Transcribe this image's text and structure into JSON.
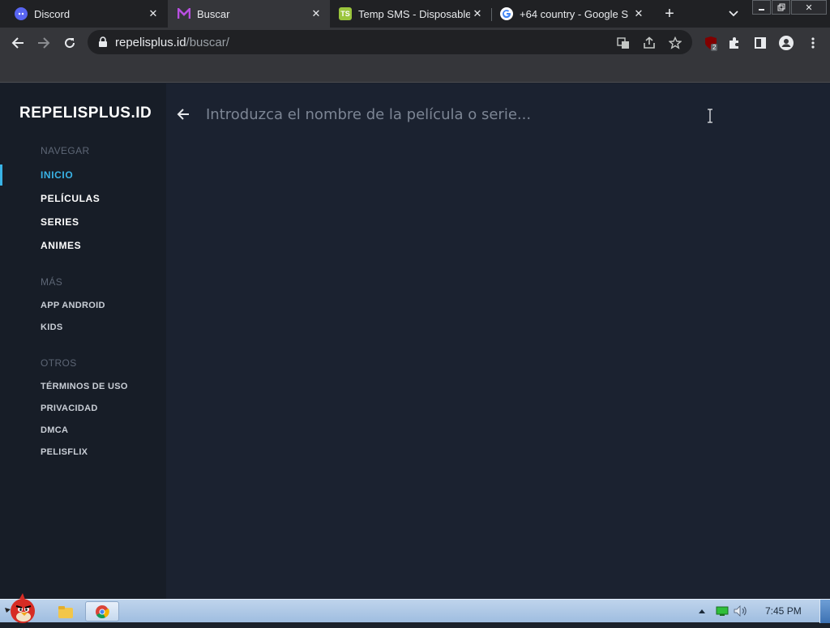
{
  "browser": {
    "tabs": [
      {
        "title": "Discord",
        "favicon": "discord-icon",
        "active": false
      },
      {
        "title": "Buscar",
        "favicon": "repelisplus-icon",
        "active": true
      },
      {
        "title": "Temp SMS - Disposable",
        "favicon": "tempsms-icon",
        "favicon_text": "TS",
        "active": false
      },
      {
        "title": "+64 country - Google S",
        "favicon": "google-icon",
        "active": false
      }
    ],
    "url": {
      "domain": "repelisplus.id",
      "path": "/buscar/"
    },
    "extension_badge": "2"
  },
  "site": {
    "brand": "REPELISPLUS.ID",
    "sections": [
      {
        "title": "NAVEGAR",
        "items": [
          "INICIO",
          "PELÍCULAS",
          "SERIES",
          "ANIMES"
        ],
        "active_item": "INICIO"
      },
      {
        "title": "MÁS",
        "items": [
          "APP ANDROID",
          "KIDS"
        ]
      },
      {
        "title": "OTROS",
        "items": [
          "TÉRMINOS DE USO",
          "PRIVACIDAD",
          "DMCA",
          "PELISFLIX"
        ]
      }
    ],
    "search": {
      "placeholder": "Introduzca el nombre de la película o serie...",
      "value": ""
    }
  },
  "taskbar": {
    "clock": "7:45 PM"
  },
  "colors": {
    "accent": "#39b3e6",
    "page_bg": "#1b2230",
    "sidebar_bg": "#171d27"
  }
}
